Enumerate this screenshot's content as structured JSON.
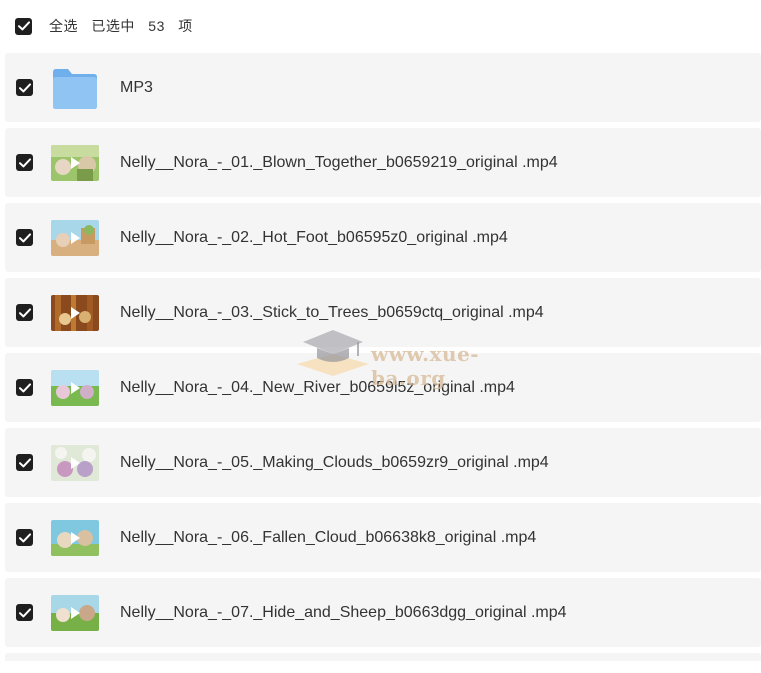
{
  "toolbar": {
    "select_all_label": "全选",
    "selected_prefix": "已选中",
    "selected_count": "53",
    "selected_suffix": "项",
    "checked": true
  },
  "items": [
    {
      "type": "folder",
      "name": "MP3",
      "icon": "folder-icon",
      "checked": true
    },
    {
      "type": "video",
      "name": "Nelly__Nora_-_01._Blown_Together_b0659219_original .mp4",
      "icon": "video-thumbnail",
      "checked": true
    },
    {
      "type": "video",
      "name": "Nelly__Nora_-_02._Hot_Foot_b06595z0_original .mp4",
      "icon": "video-thumbnail",
      "checked": true
    },
    {
      "type": "video",
      "name": "Nelly__Nora_-_03._Stick_to_Trees_b0659ctq_original .mp4",
      "icon": "video-thumbnail",
      "checked": true
    },
    {
      "type": "video",
      "name": "Nelly__Nora_-_04._New_River_b0659l5z_original .mp4",
      "icon": "video-thumbnail",
      "checked": true
    },
    {
      "type": "video",
      "name": "Nelly__Nora_-_05._Making_Clouds_b0659zr9_original .mp4",
      "icon": "video-thumbnail",
      "checked": true
    },
    {
      "type": "video",
      "name": "Nelly__Nora_-_06._Fallen_Cloud_b06638k8_original .mp4",
      "icon": "video-thumbnail",
      "checked": true
    },
    {
      "type": "video",
      "name": "Nelly__Nora_-_07._Hide_and_Sheep_b0663dgg_original .mp4",
      "icon": "video-thumbnail",
      "checked": true
    }
  ],
  "watermark": {
    "text": "www.xue-ba.org"
  },
  "colors": {
    "row_bg": "#f5f5f5",
    "checkbox": "#1f1f1f",
    "folder": "#7cb8ee"
  }
}
